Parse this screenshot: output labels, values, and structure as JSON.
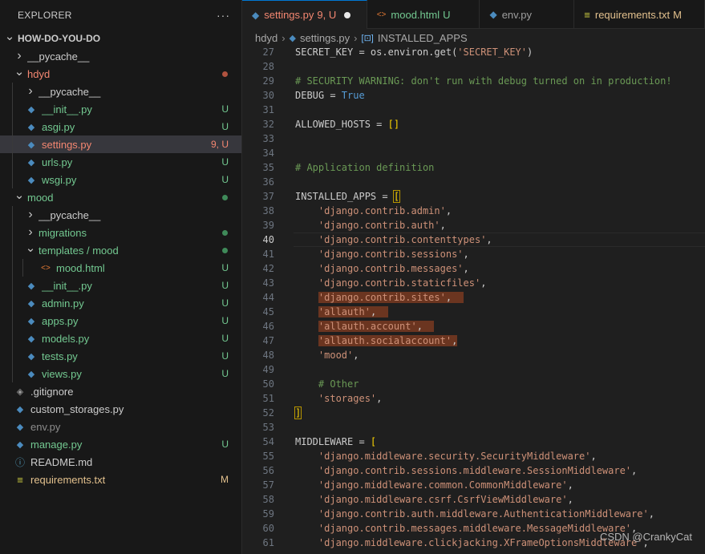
{
  "explorer": {
    "title": "EXPLORER",
    "more": "···",
    "tree": [
      {
        "label": "HOW-DO-YOU-DO",
        "depth": 0,
        "chevron": "down",
        "icon": "",
        "color": "#cccccc",
        "status": "",
        "root": true
      },
      {
        "label": "__pycache__",
        "depth": 1,
        "chevron": "right",
        "icon": "",
        "color": "#cccccc",
        "status": ""
      },
      {
        "label": "hdyd",
        "depth": 1,
        "chevron": "down",
        "icon": "",
        "color": "#f48771",
        "status": "",
        "dot": "#b0523f"
      },
      {
        "label": "__pycache__",
        "depth": 2,
        "chevron": "right",
        "icon": "",
        "color": "#cccccc",
        "status": ""
      },
      {
        "label": "__init__.py",
        "depth": 2,
        "chevron": "",
        "icon": "python-icon",
        "color": "#73c991",
        "status": "U"
      },
      {
        "label": "asgi.py",
        "depth": 2,
        "chevron": "",
        "icon": "python-icon",
        "color": "#73c991",
        "status": "U"
      },
      {
        "label": "settings.py",
        "depth": 2,
        "chevron": "",
        "icon": "python-icon",
        "color": "#f48771",
        "status": "9, U",
        "selected": true
      },
      {
        "label": "urls.py",
        "depth": 2,
        "chevron": "",
        "icon": "python-icon",
        "color": "#73c991",
        "status": "U"
      },
      {
        "label": "wsgi.py",
        "depth": 2,
        "chevron": "",
        "icon": "python-icon",
        "color": "#73c991",
        "status": "U"
      },
      {
        "label": "mood",
        "depth": 1,
        "chevron": "down",
        "icon": "",
        "color": "#73c991",
        "status": "",
        "dot": "#3f8a59"
      },
      {
        "label": "__pycache__",
        "depth": 2,
        "chevron": "right",
        "icon": "",
        "color": "#cccccc",
        "status": ""
      },
      {
        "label": "migrations",
        "depth": 2,
        "chevron": "right",
        "icon": "",
        "color": "#73c991",
        "status": "",
        "dot": "#3f8a59"
      },
      {
        "label": "templates / mood",
        "depth": 2,
        "chevron": "down",
        "icon": "",
        "color": "#73c991",
        "status": "",
        "dot": "#3f8a59"
      },
      {
        "label": "mood.html",
        "depth": 3,
        "chevron": "",
        "icon": "html-icon",
        "color": "#73c991",
        "status": "U"
      },
      {
        "label": "__init__.py",
        "depth": 2,
        "chevron": "",
        "icon": "python-icon",
        "color": "#73c991",
        "status": "U"
      },
      {
        "label": "admin.py",
        "depth": 2,
        "chevron": "",
        "icon": "python-icon",
        "color": "#73c991",
        "status": "U"
      },
      {
        "label": "apps.py",
        "depth": 2,
        "chevron": "",
        "icon": "python-icon",
        "color": "#73c991",
        "status": "U"
      },
      {
        "label": "models.py",
        "depth": 2,
        "chevron": "",
        "icon": "python-icon",
        "color": "#73c991",
        "status": "U"
      },
      {
        "label": "tests.py",
        "depth": 2,
        "chevron": "",
        "icon": "python-icon",
        "color": "#73c991",
        "status": "U"
      },
      {
        "label": "views.py",
        "depth": 2,
        "chevron": "",
        "icon": "python-icon",
        "color": "#73c991",
        "status": "U"
      },
      {
        "label": ".gitignore",
        "depth": 1,
        "chevron": "",
        "icon": "git-icon",
        "color": "#cccccc",
        "status": ""
      },
      {
        "label": "custom_storages.py",
        "depth": 1,
        "chevron": "",
        "icon": "python-icon",
        "color": "#cccccc",
        "status": ""
      },
      {
        "label": "env.py",
        "depth": 1,
        "chevron": "",
        "icon": "python-icon",
        "color": "#8c8c8c",
        "status": ""
      },
      {
        "label": "manage.py",
        "depth": 1,
        "chevron": "",
        "icon": "python-icon",
        "color": "#73c991",
        "status": "U"
      },
      {
        "label": "README.md",
        "depth": 1,
        "chevron": "",
        "icon": "info-icon",
        "color": "#cccccc",
        "status": ""
      },
      {
        "label": "requirements.txt",
        "depth": 1,
        "chevron": "",
        "icon": "lines-icon",
        "color": "#e2c08d",
        "status": "M"
      }
    ]
  },
  "tabs": [
    {
      "label": "settings.py",
      "icon": "python-icon",
      "status": "9, U",
      "active": true,
      "dirty": true,
      "color": "#f48771"
    },
    {
      "label": "mood.html",
      "icon": "html-icon",
      "status": "U",
      "active": false,
      "color": "#73c991"
    },
    {
      "label": "env.py",
      "icon": "python-icon",
      "status": "",
      "active": false,
      "color": "#9d9d9d"
    },
    {
      "label": "requirements.txt",
      "icon": "lines-icon",
      "status": "M",
      "active": false,
      "color": "#e2c08d"
    }
  ],
  "breadcrumb": {
    "folder": "hdyd",
    "file": "settings.py",
    "symbol": "INSTALLED_APPS"
  },
  "editor": {
    "current_line": "40",
    "lines": [
      {
        "n": "27",
        "tokens": [
          [
            "plain",
            "SECRET_KEY = os.environ.get("
          ],
          [
            "str",
            "'SECRET_KEY'"
          ],
          [
            "plain",
            ")"
          ]
        ]
      },
      {
        "n": "28",
        "tokens": []
      },
      {
        "n": "29",
        "tokens": [
          [
            "com",
            "# SECURITY WARNING: don't run with debug turned on in production!"
          ]
        ]
      },
      {
        "n": "30",
        "tokens": [
          [
            "plain",
            "DEBUG = "
          ],
          [
            "kw",
            "True"
          ]
        ]
      },
      {
        "n": "31",
        "tokens": []
      },
      {
        "n": "32",
        "tokens": [
          [
            "plain",
            "ALLOWED_HOSTS = "
          ],
          [
            "br",
            "[]"
          ]
        ]
      },
      {
        "n": "33",
        "tokens": []
      },
      {
        "n": "34",
        "tokens": []
      },
      {
        "n": "35",
        "tokens": [
          [
            "com",
            "# Application definition"
          ]
        ]
      },
      {
        "n": "36",
        "tokens": []
      },
      {
        "n": "37",
        "tokens": [
          [
            "plain",
            "INSTALLED_APPS = "
          ],
          [
            "brbox",
            "["
          ]
        ]
      },
      {
        "n": "38",
        "tokens": [
          [
            "plain",
            "    "
          ],
          [
            "str",
            "'django.contrib.admin'"
          ],
          [
            "plain",
            ","
          ]
        ]
      },
      {
        "n": "39",
        "tokens": [
          [
            "plain",
            "    "
          ],
          [
            "str",
            "'django.contrib.auth'"
          ],
          [
            "plain",
            ","
          ]
        ]
      },
      {
        "n": "40",
        "tokens": [
          [
            "plain",
            "    "
          ],
          [
            "str",
            "'django.contrib.contenttypes'"
          ],
          [
            "plain",
            ","
          ]
        ]
      },
      {
        "n": "41",
        "tokens": [
          [
            "plain",
            "    "
          ],
          [
            "str",
            "'django.contrib.sessions'"
          ],
          [
            "plain",
            ","
          ]
        ]
      },
      {
        "n": "42",
        "tokens": [
          [
            "plain",
            "    "
          ],
          [
            "str",
            "'django.contrib.messages'"
          ],
          [
            "plain",
            ","
          ]
        ]
      },
      {
        "n": "43",
        "tokens": [
          [
            "plain",
            "    "
          ],
          [
            "str",
            "'django.contrib.staticfiles'"
          ],
          [
            "plain",
            ","
          ]
        ]
      },
      {
        "n": "44",
        "hl": true,
        "tokens": [
          [
            "plain",
            "    "
          ],
          [
            "str",
            "'django.contrib.sites'"
          ],
          [
            "plain",
            ",  "
          ]
        ]
      },
      {
        "n": "45",
        "hl": true,
        "tokens": [
          [
            "plain",
            "    "
          ],
          [
            "str",
            "'allauth'"
          ],
          [
            "plain",
            ",  "
          ]
        ]
      },
      {
        "n": "46",
        "hl": true,
        "tokens": [
          [
            "plain",
            "    "
          ],
          [
            "str",
            "'allauth.account'"
          ],
          [
            "plain",
            ",  "
          ]
        ]
      },
      {
        "n": "47",
        "hl": true,
        "tokens": [
          [
            "plain",
            "    "
          ],
          [
            "str",
            "'allauth.socialaccount'"
          ],
          [
            "plain",
            ","
          ]
        ]
      },
      {
        "n": "48",
        "tokens": [
          [
            "plain",
            "    "
          ],
          [
            "str",
            "'mood'"
          ],
          [
            "plain",
            ","
          ]
        ]
      },
      {
        "n": "49",
        "tokens": []
      },
      {
        "n": "50",
        "tokens": [
          [
            "plain",
            "    "
          ],
          [
            "com",
            "# Other"
          ]
        ]
      },
      {
        "n": "51",
        "tokens": [
          [
            "plain",
            "    "
          ],
          [
            "str",
            "'storages'"
          ],
          [
            "plain",
            ","
          ]
        ]
      },
      {
        "n": "52",
        "tokens": [
          [
            "brbox",
            "]"
          ]
        ]
      },
      {
        "n": "53",
        "tokens": []
      },
      {
        "n": "54",
        "tokens": [
          [
            "plain",
            "MIDDLEWARE = "
          ],
          [
            "br",
            "["
          ]
        ]
      },
      {
        "n": "55",
        "tokens": [
          [
            "plain",
            "    "
          ],
          [
            "str",
            "'django.middleware.security.SecurityMiddleware'"
          ],
          [
            "plain",
            ","
          ]
        ]
      },
      {
        "n": "56",
        "tokens": [
          [
            "plain",
            "    "
          ],
          [
            "str",
            "'django.contrib.sessions.middleware.SessionMiddleware'"
          ],
          [
            "plain",
            ","
          ]
        ]
      },
      {
        "n": "57",
        "tokens": [
          [
            "plain",
            "    "
          ],
          [
            "str",
            "'django.middleware.common.CommonMiddleware'"
          ],
          [
            "plain",
            ","
          ]
        ]
      },
      {
        "n": "58",
        "tokens": [
          [
            "plain",
            "    "
          ],
          [
            "str",
            "'django.middleware.csrf.CsrfViewMiddleware'"
          ],
          [
            "plain",
            ","
          ]
        ]
      },
      {
        "n": "59",
        "tokens": [
          [
            "plain",
            "    "
          ],
          [
            "str",
            "'django.contrib.auth.middleware.AuthenticationMiddleware'"
          ],
          [
            "plain",
            ","
          ]
        ]
      },
      {
        "n": "60",
        "tokens": [
          [
            "plain",
            "    "
          ],
          [
            "str",
            "'django.contrib.messages.middleware.MessageMiddleware'"
          ],
          [
            "plain",
            ","
          ]
        ]
      },
      {
        "n": "61",
        "tokens": [
          [
            "plain",
            "    "
          ],
          [
            "str",
            "'django.middleware.clickjacking.XFrameOptionsMiddleware'"
          ],
          [
            "plain",
            ","
          ]
        ]
      }
    ]
  },
  "watermark": "CSDN @CrankyCat"
}
